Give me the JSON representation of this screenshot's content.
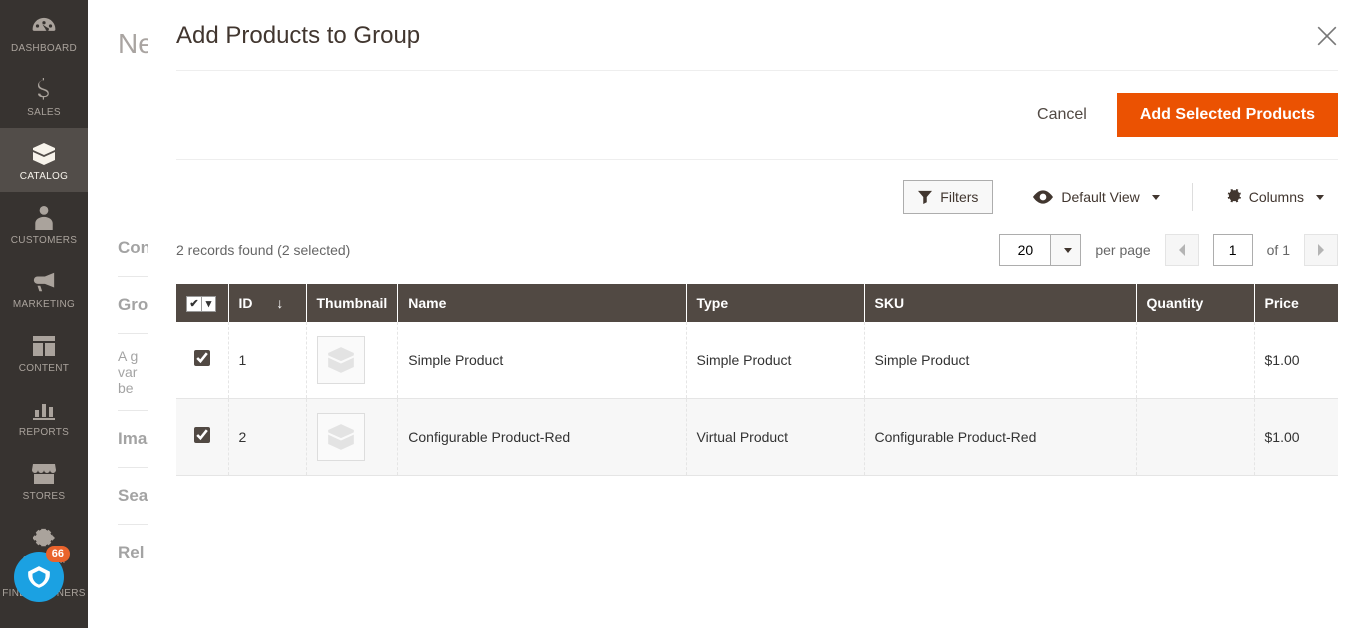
{
  "sidebar": {
    "items": [
      {
        "label": "Dashboard"
      },
      {
        "label": "Sales"
      },
      {
        "label": "Catalog"
      },
      {
        "label": "Customers"
      },
      {
        "label": "Marketing"
      },
      {
        "label": "Content"
      },
      {
        "label": "Reports"
      },
      {
        "label": "Stores"
      },
      {
        "label": "System"
      },
      {
        "label": "Find Partners"
      }
    ],
    "badge": "66"
  },
  "background": {
    "title": "New",
    "sections": {
      "con": "Con",
      "gro": "Gro",
      "hint_a": "A g",
      "hint_v": "var",
      "hint_b": "be",
      "ima": "Ima",
      "sea": "Sea",
      "rel": "Rel"
    }
  },
  "modal": {
    "title": "Add Products to Group",
    "cancel": "Cancel",
    "add_selected": "Add Selected Products",
    "filters": "Filters",
    "default_view": "Default View",
    "columns": "Columns",
    "records_found": "2 records found (2 selected)",
    "per_page_value": "20",
    "per_page_label": "per page",
    "page_value": "1",
    "of_label": "of 1",
    "headers": {
      "id": "ID",
      "thumb": "Thumbnail",
      "name": "Name",
      "type": "Type",
      "sku": "SKU",
      "qty": "Quantity",
      "price": "Price"
    },
    "rows": [
      {
        "id": "1",
        "name": "Simple Product",
        "type": "Simple Product",
        "sku": "Simple Product",
        "qty": "",
        "price": "$1.00"
      },
      {
        "id": "2",
        "name": "Configurable Product-Red",
        "type": "Virtual Product",
        "sku": "Configurable Product-Red",
        "qty": "",
        "price": "$1.00"
      }
    ]
  }
}
